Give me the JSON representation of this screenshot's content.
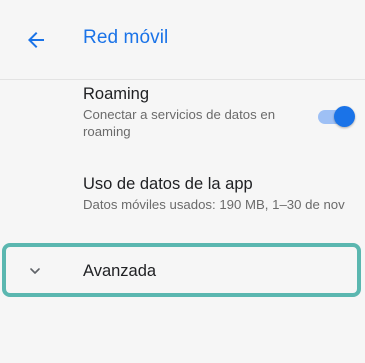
{
  "header": {
    "title": "Red móvil"
  },
  "roaming": {
    "title": "Roaming",
    "subtitle": "Conectar a servicios de datos en roaming",
    "toggle_state": "on"
  },
  "app_data_usage": {
    "title": "Uso de datos de la app",
    "subtitle": "Datos móviles usados: 190 MB, 1–30 de nov"
  },
  "advanced": {
    "label": "Avanzada"
  },
  "colors": {
    "accent": "#1a73e8",
    "highlight_border": "#5bb7b0",
    "background": "#f6f6f6"
  }
}
